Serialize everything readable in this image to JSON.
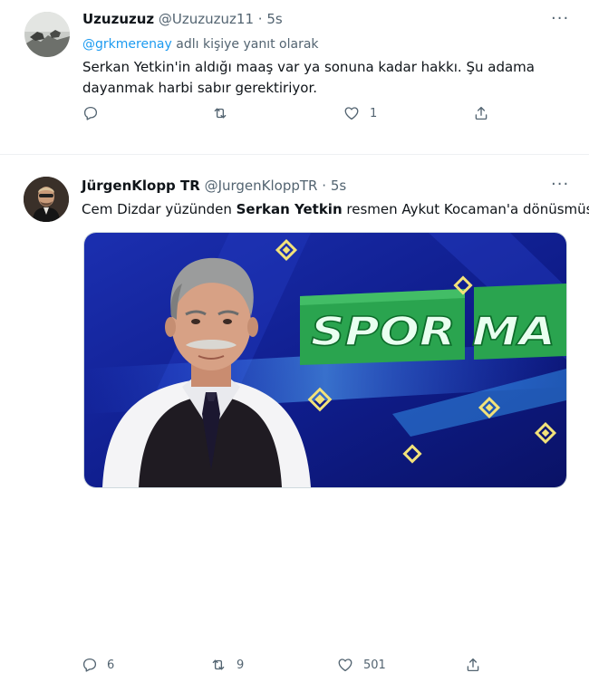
{
  "tweets": [
    {
      "author_name": "Uzuzuzuz",
      "handle": "@Uzuzuzuz11",
      "separator": "·",
      "time": "5s",
      "more_glyph": "···",
      "reply_mention": "@grkmerenay",
      "reply_suffix": "adlı kişiye yanıt olarak",
      "text": "Serkan Yetkin'in aldığı maaş var ya sonuna kadar hakkı. Şu adama dayanmak harbi sabır gerektiriyor.",
      "counts": {
        "reply": "",
        "retweet": "",
        "like": "1"
      }
    },
    {
      "author_name": "JürgenKlopp TR",
      "handle": "@JurgenKloppTR",
      "separator": "·",
      "time": "5s",
      "more_glyph": "···",
      "text_before": "Cem Dizdar yüzünden ",
      "text_bold": "Serkan Yetkin",
      "text_after": " resmen Aykut Kocaman'a dönüsmüs.",
      "media_text": "SPOR MA",
      "counts": {
        "reply": "6",
        "retweet": "9",
        "like": "501"
      }
    }
  ],
  "colors": {
    "accent": "#1d9bf0",
    "secondary_text": "#536471",
    "media_bg": "#0f1d8c",
    "banner_green": "#2aa44f"
  },
  "icons": [
    "reply-icon",
    "retweet-icon",
    "like-icon",
    "share-icon",
    "more-icon"
  ]
}
